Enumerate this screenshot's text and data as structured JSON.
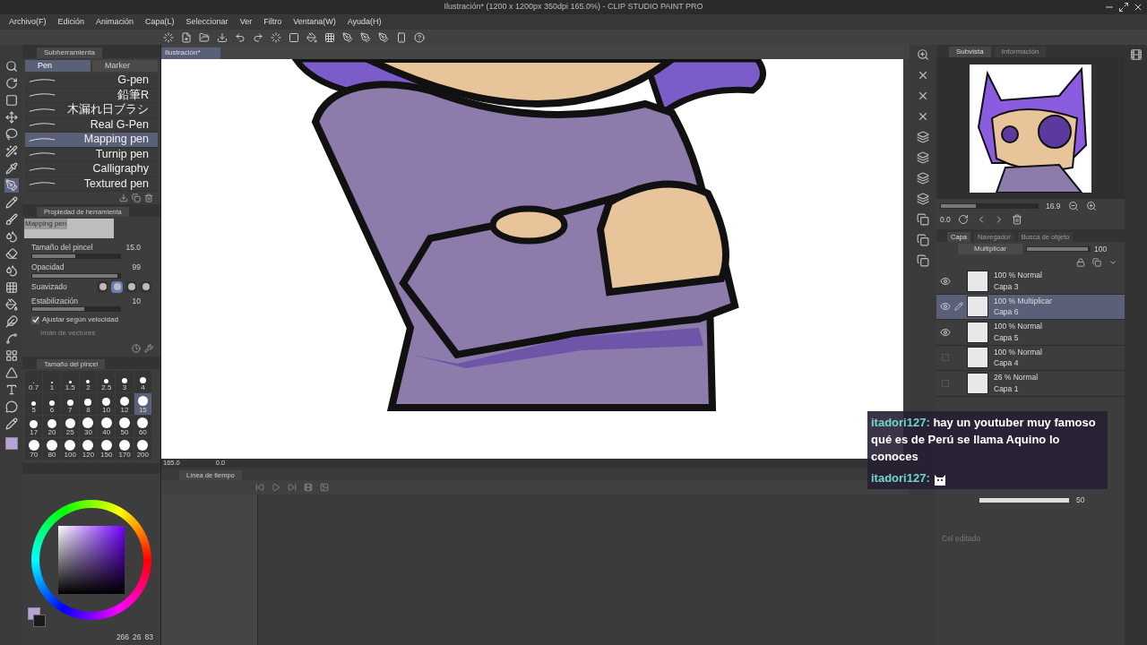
{
  "window": {
    "title": "Ilustración* (1200 x 1200px 350dpi 165.0%)  - CLIP STUDIO PAINT PRO"
  },
  "menu": [
    "Archivo(F)",
    "Edición",
    "Animación",
    "Capa(L)",
    "Seleccionar",
    "Ver",
    "Filtro",
    "Ventana(W)",
    "Ayuda(H)"
  ],
  "subtool": {
    "title": "Subherramienta",
    "tabs": [
      {
        "label": "Pen",
        "selected": true
      },
      {
        "label": "Marker",
        "selected": false
      }
    ],
    "brushes": [
      {
        "name": "G-pen",
        "selected": false
      },
      {
        "name": "鉛筆R",
        "selected": false
      },
      {
        "name": "木漏れ日ブラシ",
        "selected": false
      },
      {
        "name": "Real G-Pen",
        "selected": false
      },
      {
        "name": "Mapping pen",
        "selected": true
      },
      {
        "name": "Turnip pen",
        "selected": false
      },
      {
        "name": "Calligraphy",
        "selected": false
      },
      {
        "name": "Textured pen",
        "selected": false
      }
    ]
  },
  "tool_property": {
    "title": "Propiedad de herramienta",
    "preview_name": "Mapping pen",
    "sliders": [
      {
        "label": "Tamaño del pincel",
        "value": "15.0",
        "level": 0.5
      },
      {
        "label": "Opacidad",
        "value": "99",
        "level": 0.99
      }
    ],
    "smoothing": {
      "label": "Suavizado",
      "options": [
        {
          "selected": false
        },
        {
          "selected": true
        },
        {
          "selected": false
        },
        {
          "selected": false
        }
      ]
    },
    "stabilization": {
      "label": "Estabilización",
      "value": "10",
      "level": 0.6
    },
    "checkbox": {
      "label": "Ajustar según velocidad",
      "checked": true
    },
    "vector_magnet": {
      "label": "Imán de vectores",
      "disabled": true
    }
  },
  "brush_size": {
    "title": "Tamaño del pincel",
    "sizes": [
      {
        "label": "0.7",
        "selected": false
      },
      {
        "label": "1",
        "selected": false
      },
      {
        "label": "1.5",
        "selected": false
      },
      {
        "label": "2",
        "selected": false
      },
      {
        "label": "2.5",
        "selected": false
      },
      {
        "label": "3",
        "selected": false
      },
      {
        "label": "4",
        "selected": false
      },
      {
        "label": "5",
        "selected": false
      },
      {
        "label": "6",
        "selected": false
      },
      {
        "label": "7",
        "selected": false
      },
      {
        "label": "8",
        "selected": false
      },
      {
        "label": "10",
        "selected": false
      },
      {
        "label": "12",
        "selected": false
      },
      {
        "label": "15",
        "selected": true
      },
      {
        "label": "17",
        "selected": false
      },
      {
        "label": "20",
        "selected": false
      },
      {
        "label": "25",
        "selected": false
      },
      {
        "label": "30",
        "selected": false
      },
      {
        "label": "40",
        "selected": false
      },
      {
        "label": "50",
        "selected": false
      },
      {
        "label": "60",
        "selected": false
      },
      {
        "label": "70",
        "selected": false
      },
      {
        "label": "80",
        "selected": false
      },
      {
        "label": "100",
        "selected": false
      },
      {
        "label": "120",
        "selected": false
      },
      {
        "label": "150",
        "selected": false
      },
      {
        "label": "170",
        "selected": false
      },
      {
        "label": "200",
        "selected": false
      }
    ]
  },
  "color": {
    "h": "266",
    "s": "26",
    "v": "83"
  },
  "canvas": {
    "tab": "Ilustración*",
    "zoom": "165.0",
    "rotation": "0.0"
  },
  "timeline": {
    "title": "Línea de tiempo"
  },
  "subview": {
    "tabs": [
      {
        "label": "Subvista",
        "selected": true
      },
      {
        "label": "Información",
        "selected": false
      }
    ],
    "zoom": "16.9",
    "zoom_slider": {
      "level": 0.37
    },
    "rotation": "0.0"
  },
  "layers": {
    "tabs": [
      {
        "label": "Capa",
        "selected": true
      },
      {
        "label": "Navegador",
        "selected": false
      },
      {
        "label": "Busca de objeto",
        "selected": false
      }
    ],
    "blend": "Multiplicar",
    "opacity": "100",
    "opacity_slider": {
      "level": 1
    },
    "rows": [
      {
        "mode": "100 % Normal",
        "name": "Capa 3",
        "visible": true,
        "selected": false
      },
      {
        "mode": "100 % Multiplicar",
        "name": "Capa 6",
        "visible": true,
        "selected": true
      },
      {
        "mode": "100 % Normal",
        "name": "Capa 5",
        "visible": true,
        "selected": false
      },
      {
        "mode": "100 % Normal",
        "name": "Capa 4",
        "visible": false,
        "selected": false
      },
      {
        "mode": "26 % Normal",
        "name": "Capa 1",
        "visible": false,
        "selected": false
      }
    ]
  },
  "animation": {
    "opacity": "50",
    "status": "Cel editado"
  },
  "chat": [
    {
      "user": "itadori127:",
      "message": "hay un youtuber muy famoso qué es de Perú se llama Aquino lo conoces",
      "kind": "text"
    },
    {
      "user": "itadori127:",
      "kind": "emote"
    }
  ]
}
